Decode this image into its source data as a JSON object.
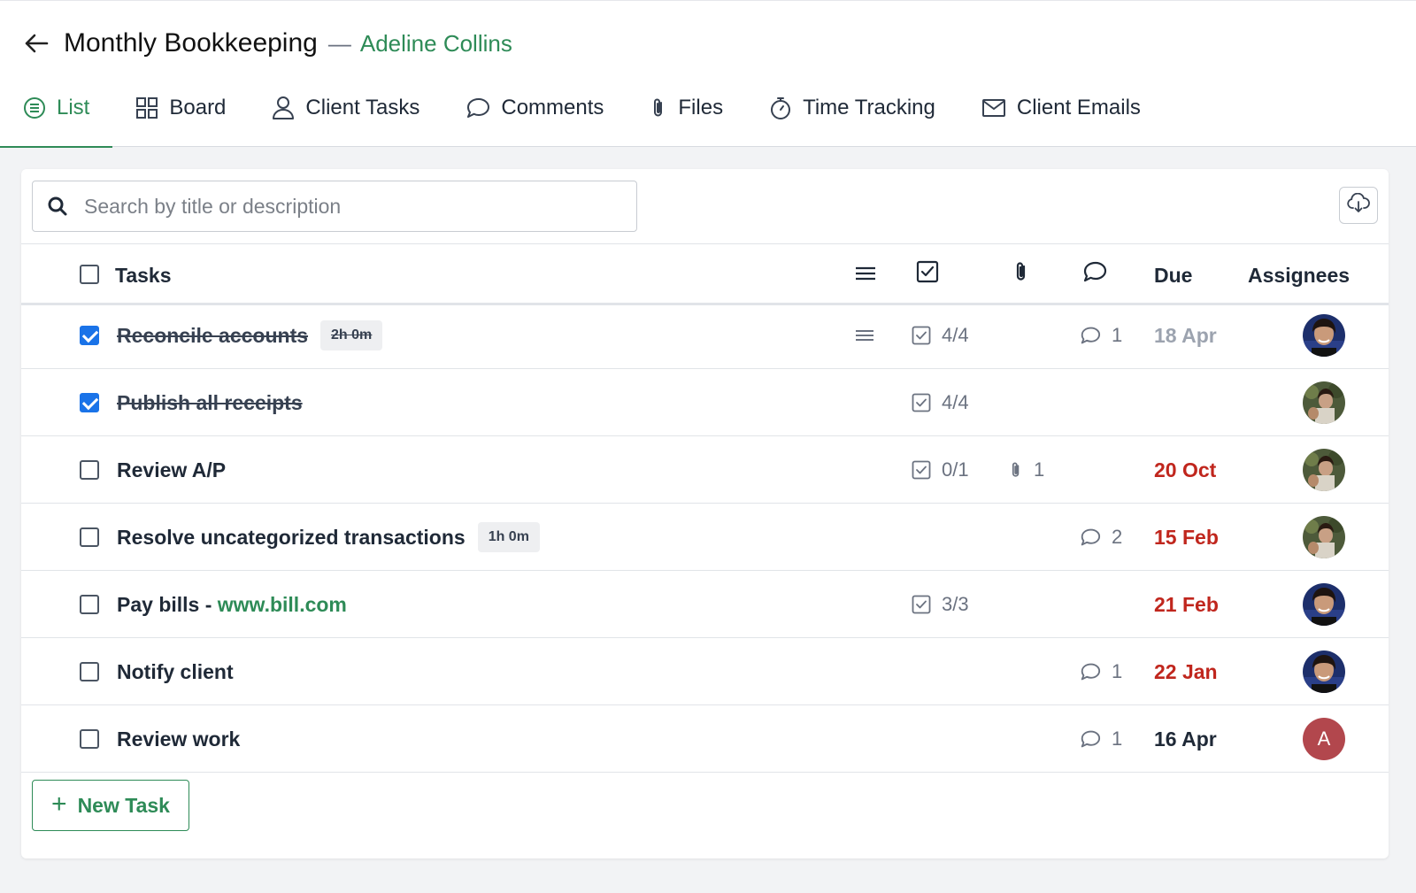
{
  "header": {
    "title": "Monthly Bookkeeping",
    "separator": "—",
    "client_name": "Adeline Collins"
  },
  "tabs": [
    {
      "label": "List",
      "icon": "list-icon",
      "active": true
    },
    {
      "label": "Board",
      "icon": "board-icon"
    },
    {
      "label": "Client Tasks",
      "icon": "person-icon"
    },
    {
      "label": "Comments",
      "icon": "comment-icon"
    },
    {
      "label": "Files",
      "icon": "paperclip-icon"
    },
    {
      "label": "Time Tracking",
      "icon": "stopwatch-icon"
    },
    {
      "label": "Client Emails",
      "icon": "envelope-icon"
    }
  ],
  "search": {
    "placeholder": "Search by title or description",
    "value": ""
  },
  "table": {
    "headers": {
      "tasks": "Tasks",
      "due": "Due",
      "assignees": "Assignees"
    },
    "rows": [
      {
        "title": "Reconcile accounts",
        "done": true,
        "time": "2h 0m",
        "description": true,
        "checklist": "4/4",
        "files": "",
        "comments": "1",
        "due": "18 Apr",
        "due_status": "done",
        "assignee": "photo-a"
      },
      {
        "title": "Publish all receipts",
        "done": true,
        "time": "",
        "description": false,
        "checklist": "4/4",
        "files": "",
        "comments": "",
        "due": "",
        "due_status": "",
        "assignee": "photo-b"
      },
      {
        "title": "Review A/P",
        "done": false,
        "time": "",
        "description": false,
        "checklist": "0/1",
        "files": "1",
        "comments": "",
        "due": "20 Oct",
        "due_status": "overdue",
        "assignee": "photo-b"
      },
      {
        "title": "Resolve uncategorized transactions",
        "done": false,
        "time": "1h 0m",
        "description": false,
        "checklist": "",
        "files": "",
        "comments": "2",
        "due": "15 Feb",
        "due_status": "overdue",
        "assignee": "photo-b"
      },
      {
        "title": "Pay bills - ",
        "link": "www.bill.com",
        "done": false,
        "time": "",
        "description": false,
        "checklist": "3/3",
        "files": "",
        "comments": "",
        "due": "21 Feb",
        "due_status": "overdue",
        "assignee": "photo-a"
      },
      {
        "title": "Notify client",
        "done": false,
        "time": "",
        "description": false,
        "checklist": "",
        "files": "",
        "comments": "1",
        "due": "22 Jan",
        "due_status": "overdue",
        "assignee": "photo-a"
      },
      {
        "title": "Review work",
        "done": false,
        "time": "",
        "description": false,
        "checklist": "",
        "files": "",
        "comments": "1",
        "due": "16 Apr",
        "due_status": "normal",
        "assignee": "initial",
        "assignee_initial": "A"
      }
    ]
  },
  "actions": {
    "new_task_label": "New Task"
  },
  "colors": {
    "brand_green": "#2e8b57",
    "overdue_red": "#c0261d",
    "done_gray": "#9ca3af",
    "checkbox_blue": "#1a73e8",
    "initial_avatar": "#b2474d"
  }
}
